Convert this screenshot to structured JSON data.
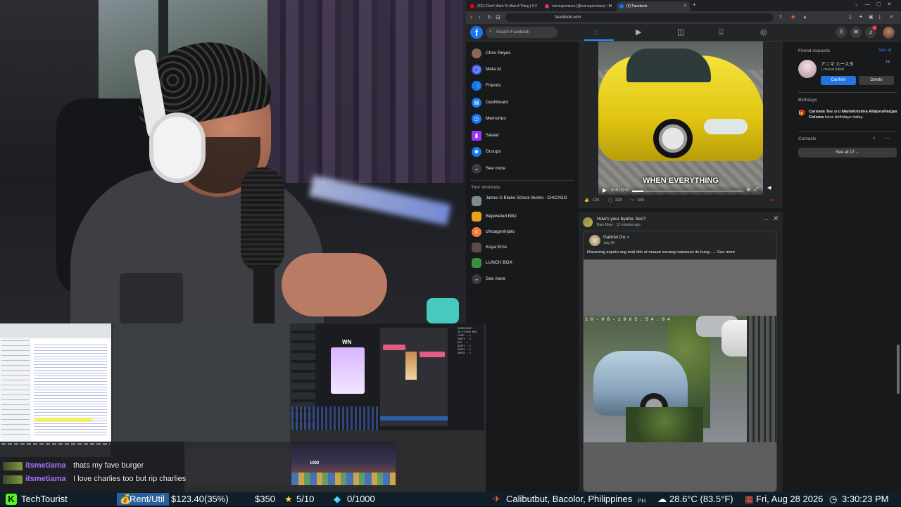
{
  "browser": {
    "tabs": [
      {
        "title": "(40) I Don't Want To Miss A Thing | A",
        "favicon_color": "#ff0000",
        "active": false
      },
      {
        "title": "not-supermicro (@not.supermicro) • In",
        "favicon_color": "#e1306c",
        "active": false
      },
      {
        "title": "(3) Facebook",
        "favicon_color": "#1877f2",
        "active": true
      }
    ],
    "url": "facebook.com"
  },
  "facebook": {
    "search_placeholder": "Search Facebook",
    "notif_count": "4",
    "left_nav": [
      {
        "label": "Chris Reyes",
        "icon": "profile-avatar",
        "color": "#8a6a55"
      },
      {
        "label": "Meta AI",
        "icon": "meta-ai-icon",
        "color": "#6a3de8"
      },
      {
        "label": "Friends",
        "icon": "friends-icon",
        "color": "#1877f2"
      },
      {
        "label": "Dashboard",
        "icon": "dashboard-icon",
        "color": "#1877f2"
      },
      {
        "label": "Memories",
        "icon": "clock-icon",
        "color": "#1877f2"
      },
      {
        "label": "Saved",
        "icon": "bookmark-icon",
        "color": "#a033ff"
      },
      {
        "label": "Groups",
        "icon": "groups-icon",
        "color": "#1877f2"
      },
      {
        "label": "See more",
        "icon": "chevron-down-icon",
        "color": "#3a3b3c"
      }
    ],
    "shortcuts_title": "Your shortcuts",
    "shortcuts": [
      {
        "label": "James G Blaine School Alumni - CHICAGO",
        "color": "#7d8b91"
      },
      {
        "label": "Bejeweled Blitz",
        "color": "#e6a21a"
      },
      {
        "label": "chicagoninjatv",
        "color": "#f07a3a"
      },
      {
        "label": "Kuya Erns",
        "color": "#5a4c44"
      },
      {
        "label": "LUNCH BOX",
        "color": "#3a8e3e"
      },
      {
        "label": "See more",
        "color": "#3a3b3c"
      }
    ],
    "video_post": {
      "caption": "WHEN EVERYTHING",
      "time": "0:15 / 12:57",
      "progress": 0.1,
      "likes": "12K",
      "comments": "328",
      "shares": "659"
    },
    "post2": {
      "title": "How's your byahe, bes?",
      "meta": "Bam Elasr · 13 minutes ago",
      "shared_author": "Gabriel Go",
      "shared_date": "July 28",
      "text": "Maraming aspeto ang mali dito at maaari sanang naiwasan ito kung......",
      "see_more": "See more",
      "cctv_timestamp": "2 0 - 0 8 - 1 9 0 5 : 5 4 : 0 4"
    },
    "right": {
      "friend_requests_title": "Friend requests",
      "see_all": "See all",
      "request_name": "アニマ エースタ",
      "mutual": "1 mutual friend",
      "request_time": "1w",
      "confirm": "Confirm",
      "delete": "Delete",
      "birthdays_title": "Birthdays",
      "bday_name1": "Carmela Tee",
      "bday_and": " and ",
      "bday_name2": "MariaKristina AlfajoraVargas Coloma",
      "bday_suffix": " have birthdays today.",
      "contacts_title": "Contacts",
      "see_all_contacts": "See all 17"
    }
  },
  "chat": [
    {
      "user": "itsmetiama",
      "message": "thats my fave burger"
    },
    {
      "user": "itsmetiama",
      "message": "I love charlies too but rip charlies"
    }
  ],
  "editor_panel_text": "SCREENSHOT\nIN STUDIO MAX\nLEVEL : 1\nPARTY : 3\nHAT : 1\nSHIRT : 2\nPANTS : 1\nSHOES : 2",
  "game_score": "1092",
  "ticker": {
    "channel": "TechTourist",
    "rent_label": "Rent/Util",
    "rent_value": "$123.40(35%)",
    "sub_value": "$350",
    "star_label": "5/10",
    "diamond_label": "0/1000",
    "location": "Calibutbut, Bacolor, Philippines",
    "country": "PH",
    "weather": "28.6°C (83.5°F)",
    "date": "Fri, Aug 28 2026",
    "time": "3:30:23 PM",
    "colors": {
      "kick": "#53fc18",
      "bar": "#0f1e29"
    }
  }
}
